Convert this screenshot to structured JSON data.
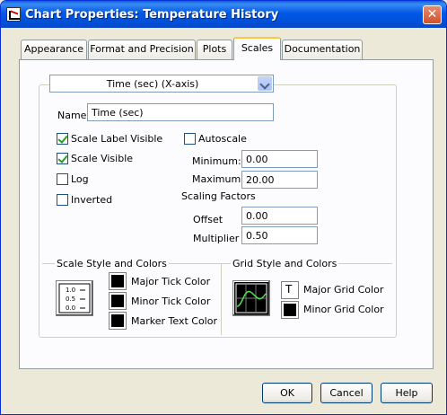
{
  "window": {
    "title": "Chart Properties: Temperature History",
    "close_glyph": "✕"
  },
  "tabs": [
    {
      "label": "Appearance"
    },
    {
      "label": "Format and Precision"
    },
    {
      "label": "Plots"
    },
    {
      "label": "Scales"
    },
    {
      "label": "Documentation"
    }
  ],
  "scales": {
    "axis_select": {
      "value": "Time (sec) (X-axis)"
    },
    "name_label": "Name",
    "name_value": "Time (sec)",
    "checks": {
      "scale_label_visible": {
        "label": "Scale Label Visible",
        "checked": true
      },
      "scale_visible": {
        "label": "Scale Visible",
        "checked": true
      },
      "log": {
        "label": "Log",
        "checked": false
      },
      "inverted": {
        "label": "Inverted",
        "checked": false
      },
      "autoscale": {
        "label": "Autoscale",
        "checked": false
      }
    },
    "minimum_label": "Minimum:",
    "minimum_value": "0.00",
    "maximum_label": "Maximum:",
    "maximum_value": "20.00",
    "scaling_factors_label": "Scaling Factors",
    "offset_label": "Offset",
    "offset_value": "0.00",
    "multiplier_label": "Multiplier",
    "multiplier_value": "0.50",
    "scale_style": {
      "title": "Scale Style and Colors",
      "tick_labels": [
        "1.0",
        "0.5",
        "0.0"
      ],
      "major_tick_label": "Major Tick Color",
      "minor_tick_label": "Minor Tick Color",
      "marker_text_label": "Marker Text Color"
    },
    "grid_style": {
      "title": "Grid Style and Colors",
      "major_grid_label": "Major Grid Color",
      "major_grid_glyph": "T",
      "minor_grid_label": "Minor Grid Color"
    }
  },
  "buttons": {
    "ok": "OK",
    "cancel": "Cancel",
    "help": "Help"
  },
  "colors": {
    "title_bar": "#0058e6",
    "active_tab_accent": "#ffc83c",
    "swatch": "#000000"
  }
}
